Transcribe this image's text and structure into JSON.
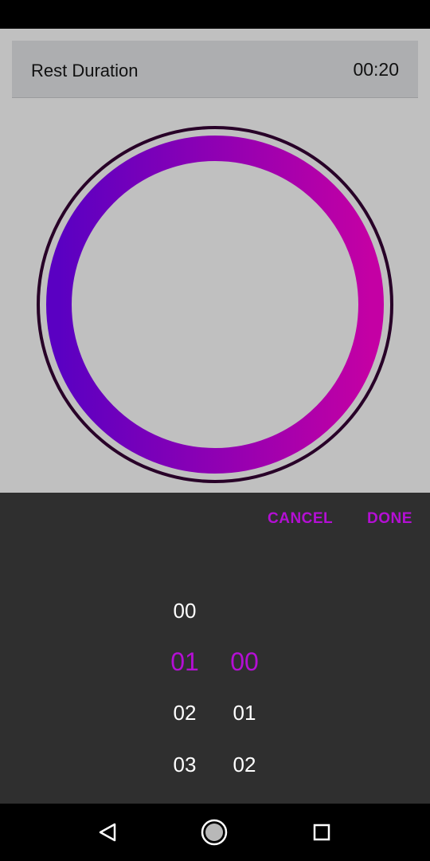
{
  "header": {
    "label": "Rest Duration",
    "value": "00:20"
  },
  "ring": {
    "gradient_start": "#5a00c2",
    "gradient_end": "#c400a4",
    "outline_color": "#280028"
  },
  "picker": {
    "cancel_label": "CANCEL",
    "done_label": "DONE",
    "accent_color": "#b40fd4",
    "minutes": {
      "items": [
        "00",
        "01",
        "02",
        "03"
      ],
      "selected": "01"
    },
    "seconds": {
      "items": [
        "00",
        "01",
        "02"
      ],
      "selected": "00"
    }
  },
  "nav": {
    "back": "back-triangle-icon",
    "home": "home-circle-icon",
    "recent": "recent-square-icon"
  }
}
